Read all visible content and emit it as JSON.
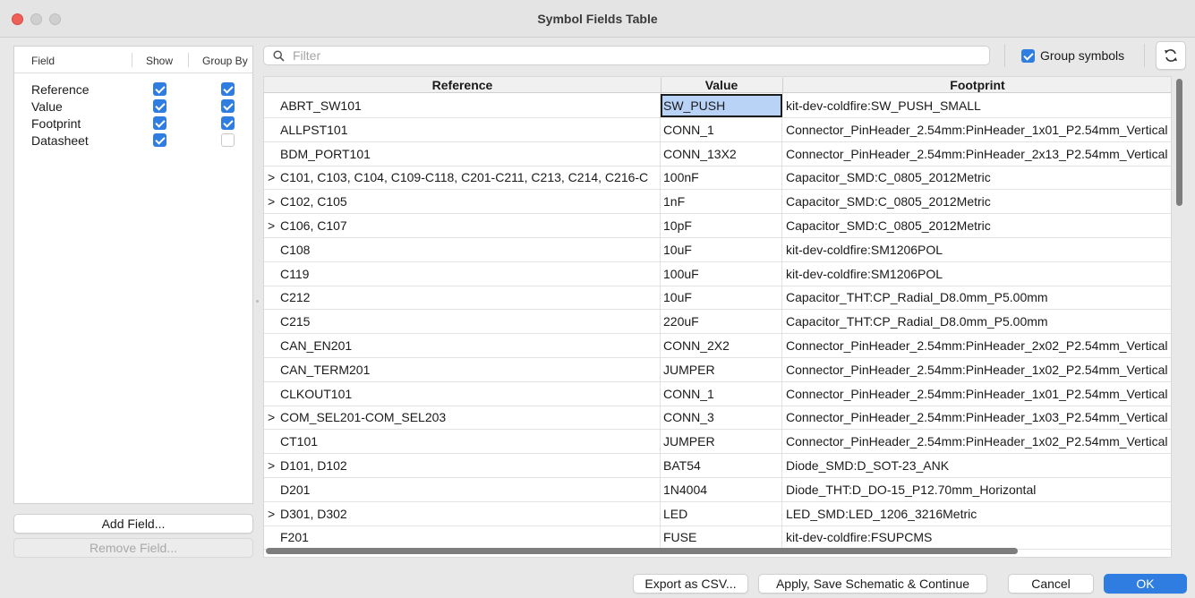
{
  "window": {
    "title": "Symbol Fields Table"
  },
  "fields_panel": {
    "headers": {
      "field": "Field",
      "show": "Show",
      "group_by": "Group By"
    },
    "rows": [
      {
        "name": "Reference",
        "show": true,
        "group_by": true
      },
      {
        "name": "Value",
        "show": true,
        "group_by": true
      },
      {
        "name": "Footprint",
        "show": true,
        "group_by": true
      },
      {
        "name": "Datasheet",
        "show": true,
        "group_by": false
      }
    ],
    "add_field": "Add Field...",
    "remove_field": "Remove Field..."
  },
  "toolbar": {
    "filter_placeholder": "Filter",
    "filter_value": "",
    "group_symbols_label": "Group symbols",
    "group_symbols_checked": true
  },
  "table": {
    "headers": {
      "reference": "Reference",
      "value": "Value",
      "footprint": "Footprint"
    },
    "rows": [
      {
        "expand": "",
        "reference": "ABRT_SW101",
        "value": "SW_PUSH",
        "footprint": "kit-dev-coldfire:SW_PUSH_SMALL",
        "selected": true
      },
      {
        "expand": "",
        "reference": "ALLPST101",
        "value": "CONN_1",
        "footprint": "Connector_PinHeader_2.54mm:PinHeader_1x01_P2.54mm_Vertical"
      },
      {
        "expand": "",
        "reference": "BDM_PORT101",
        "value": "CONN_13X2",
        "footprint": "Connector_PinHeader_2.54mm:PinHeader_2x13_P2.54mm_Vertical"
      },
      {
        "expand": ">",
        "reference": "C101, C103, C104, C109-C118, C201-C211, C213, C214, C216-C",
        "value": "100nF",
        "footprint": "Capacitor_SMD:C_0805_2012Metric"
      },
      {
        "expand": ">",
        "reference": "C102, C105",
        "value": "1nF",
        "footprint": "Capacitor_SMD:C_0805_2012Metric"
      },
      {
        "expand": ">",
        "reference": "C106, C107",
        "value": "10pF",
        "footprint": "Capacitor_SMD:C_0805_2012Metric"
      },
      {
        "expand": "",
        "reference": "C108",
        "value": "10uF",
        "footprint": "kit-dev-coldfire:SM1206POL"
      },
      {
        "expand": "",
        "reference": "C119",
        "value": "100uF",
        "footprint": "kit-dev-coldfire:SM1206POL"
      },
      {
        "expand": "",
        "reference": "C212",
        "value": "10uF",
        "footprint": "Capacitor_THT:CP_Radial_D8.0mm_P5.00mm"
      },
      {
        "expand": "",
        "reference": "C215",
        "value": "220uF",
        "footprint": "Capacitor_THT:CP_Radial_D8.0mm_P5.00mm"
      },
      {
        "expand": "",
        "reference": "CAN_EN201",
        "value": "CONN_2X2",
        "footprint": "Connector_PinHeader_2.54mm:PinHeader_2x02_P2.54mm_Vertical"
      },
      {
        "expand": "",
        "reference": "CAN_TERM201",
        "value": "JUMPER",
        "footprint": "Connector_PinHeader_2.54mm:PinHeader_1x02_P2.54mm_Vertical"
      },
      {
        "expand": "",
        "reference": "CLKOUT101",
        "value": "CONN_1",
        "footprint": "Connector_PinHeader_2.54mm:PinHeader_1x01_P2.54mm_Vertical"
      },
      {
        "expand": ">",
        "reference": "COM_SEL201-COM_SEL203",
        "value": "CONN_3",
        "footprint": "Connector_PinHeader_2.54mm:PinHeader_1x03_P2.54mm_Vertical"
      },
      {
        "expand": "",
        "reference": "CT101",
        "value": "JUMPER",
        "footprint": "Connector_PinHeader_2.54mm:PinHeader_1x02_P2.54mm_Vertical"
      },
      {
        "expand": ">",
        "reference": "D101, D102",
        "value": "BAT54",
        "footprint": "Diode_SMD:D_SOT-23_ANK"
      },
      {
        "expand": "",
        "reference": "D201",
        "value": "1N4004",
        "footprint": "Diode_THT:D_DO-15_P12.70mm_Horizontal"
      },
      {
        "expand": ">",
        "reference": "D301, D302",
        "value": "LED",
        "footprint": "LED_SMD:LED_1206_3216Metric"
      },
      {
        "expand": "",
        "reference": "F201",
        "value": "FUSE",
        "footprint": "kit-dev-coldfire:FSUPCMS"
      }
    ]
  },
  "buttons": {
    "export_csv": "Export as CSV...",
    "apply_save": "Apply, Save Schematic & Continue",
    "cancel": "Cancel",
    "ok": "OK"
  },
  "colors": {
    "accent": "#2f7de1",
    "close": "#ee5f57",
    "selection": "#b9d3f7"
  }
}
